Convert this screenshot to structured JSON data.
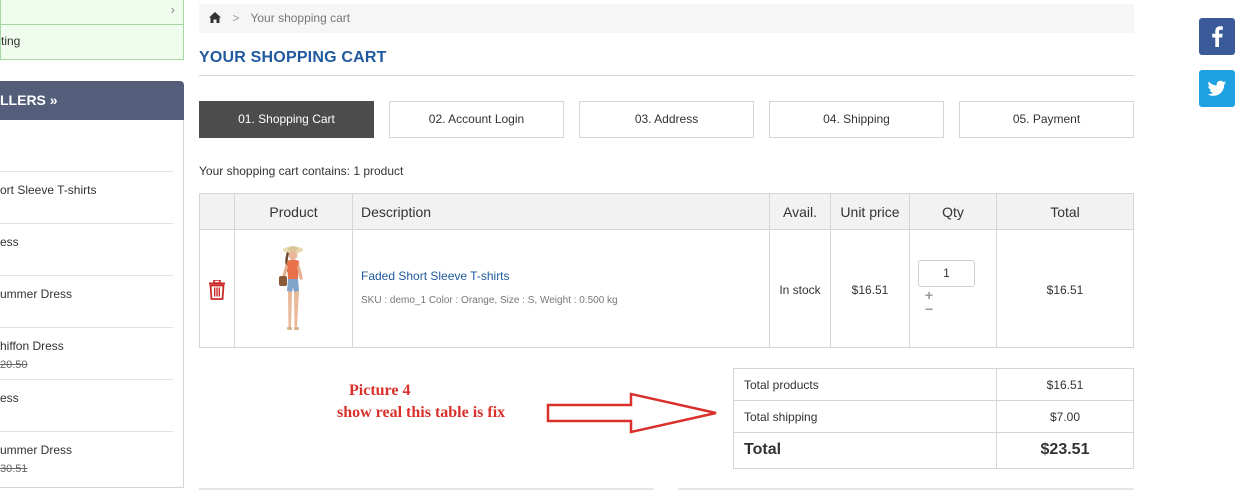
{
  "sidebar": {
    "top_item_2": "ting",
    "header": "LLERS »",
    "items": [
      {
        "name": "",
        "old_price": ""
      },
      {
        "name": "ort Sleeve T-shirts",
        "old_price": ""
      },
      {
        "name": "ess",
        "old_price": ""
      },
      {
        "name": "ummer Dress",
        "old_price": ""
      },
      {
        "name": "hiffon Dress",
        "old_price": "20.50"
      },
      {
        "name": "ess",
        "old_price": ""
      },
      {
        "name": "ummer Dress",
        "old_price": "30.51"
      }
    ]
  },
  "breadcrumb": {
    "sep": ">",
    "current": "Your shopping cart"
  },
  "page_title": "YOUR SHOPPING CART",
  "steps": [
    {
      "label": "01. Shopping Cart",
      "active": true
    },
    {
      "label": "02. Account Login",
      "active": false
    },
    {
      "label": "03. Address",
      "active": false
    },
    {
      "label": "04. Shipping",
      "active": false
    },
    {
      "label": "05. Payment",
      "active": false
    }
  ],
  "cart_summary": "Your shopping cart contains: 1 product",
  "table": {
    "headers": {
      "product": "Product",
      "description": "Description",
      "avail": "Avail.",
      "unit_price": "Unit price",
      "qty": "Qty",
      "total": "Total"
    },
    "row": {
      "name": "Faded Short Sleeve T-shirts",
      "sku": "SKU : demo_1 Color : Orange, Size : S, Weight : 0.500 kg",
      "avail": "In stock",
      "unit_price": "$16.51",
      "qty": "1",
      "qty_plus": "+",
      "qty_minus": "−",
      "total": "$16.51"
    }
  },
  "totals": {
    "products_label": "Total products",
    "products_value": "$16.51",
    "shipping_label": "Total shipping",
    "shipping_value": "$7.00",
    "total_label": "Total",
    "total_value": "$23.51"
  },
  "annotation": {
    "line1": "Picture 4",
    "line2": "show real this table is fix"
  },
  "colors": {
    "accent": "#1f5a9e",
    "annotation": "#d9302b",
    "facebook": "#3b5a99",
    "twitter": "#1da1e2",
    "step_active": "#4c4c4c"
  },
  "icons": [
    "chevron-right-icon",
    "home-icon",
    "trash-icon",
    "facebook-icon",
    "twitter-icon",
    "arrow-right-icon"
  ]
}
